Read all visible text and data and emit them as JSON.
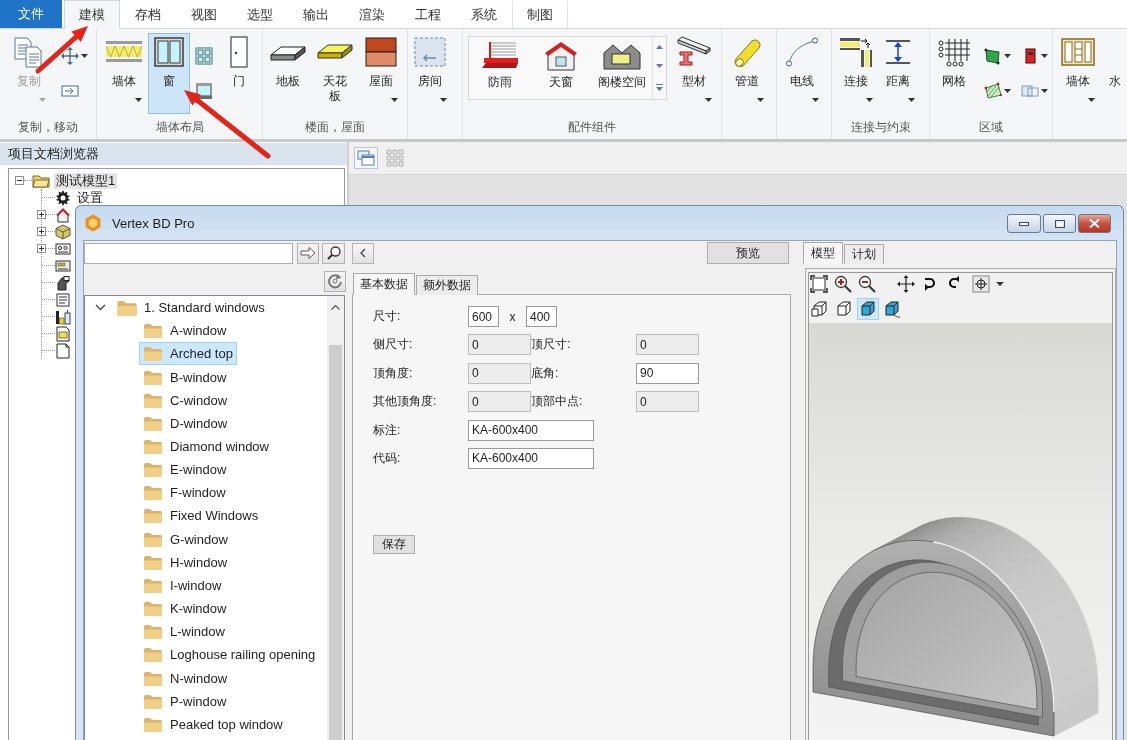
{
  "ribbon": {
    "file_menu": "文件",
    "tabs": [
      {
        "label": "建模",
        "selected": true
      },
      {
        "label": "存档",
        "selected": false
      },
      {
        "label": "视图",
        "selected": false
      },
      {
        "label": "选型",
        "selected": false
      },
      {
        "label": "输出",
        "selected": false
      },
      {
        "label": "渲染",
        "selected": false
      },
      {
        "label": "工程",
        "selected": false
      },
      {
        "label": "系统",
        "selected": false
      },
      {
        "label": "制图",
        "selected": false
      }
    ],
    "groups": [
      {
        "label": "复制，移动",
        "items": [
          {
            "kind": "large",
            "label": "复制",
            "selected": false,
            "disabled": true,
            "dropdown": true
          },
          {
            "kind": "small",
            "selected": false,
            "disabled": false,
            "dropdown": true
          },
          {
            "kind": "small",
            "selected": false,
            "disabled": false,
            "dropdown": false
          }
        ]
      },
      {
        "label": "墙体布局",
        "items": [
          {
            "kind": "large",
            "label": "墙体",
            "selected": false,
            "disabled": false,
            "dropdown": true
          },
          {
            "kind": "large",
            "label": "窗",
            "selected": true,
            "disabled": false,
            "dropdown": false
          },
          {
            "kind": "small",
            "selected": false,
            "disabled": false,
            "dropdown": false
          },
          {
            "kind": "small",
            "selected": false,
            "disabled": false,
            "dropdown": false
          },
          {
            "kind": "large",
            "label": "门",
            "selected": false,
            "disabled": false,
            "dropdown": false
          }
        ]
      },
      {
        "label": "楼面，屋面",
        "items": [
          {
            "kind": "large",
            "label": "地板",
            "selected": false,
            "disabled": false,
            "dropdown": false
          },
          {
            "kind": "large",
            "label": "天花板",
            "selected": false,
            "disabled": false,
            "dropdown": false
          },
          {
            "kind": "large",
            "label": "屋面",
            "selected": false,
            "disabled": false,
            "dropdown": true
          }
        ]
      },
      {
        "items": [
          {
            "kind": "large",
            "label": "房间",
            "selected": false,
            "disabled": false,
            "dropdown": true
          }
        ]
      },
      {
        "label": "配件组件",
        "items": [
          {
            "kind": "gallery",
            "entries": [
              {
                "label": "防雨"
              },
              {
                "label": "天窗"
              },
              {
                "label": "阁楼空间"
              }
            ]
          },
          {
            "kind": "large",
            "label": "型材",
            "selected": false,
            "disabled": false,
            "dropdown": true
          }
        ]
      },
      {
        "items": [
          {
            "kind": "large",
            "label": "管道",
            "selected": false,
            "disabled": false,
            "dropdown": true
          }
        ]
      },
      {
        "items": [
          {
            "kind": "large",
            "label": "电线",
            "selected": false,
            "disabled": false,
            "dropdown": true
          }
        ]
      },
      {
        "label": "连接与约束",
        "items": [
          {
            "kind": "large",
            "label": "连接",
            "selected": false,
            "disabled": false,
            "dropdown": true
          },
          {
            "kind": "large",
            "label": "距离",
            "selected": false,
            "disabled": false,
            "dropdown": true
          }
        ]
      },
      {
        "label": "区域",
        "items": [
          {
            "kind": "large",
            "label": "网格",
            "selected": false,
            "disabled": false,
            "dropdown": false
          },
          {
            "kind": "small",
            "selected": false,
            "disabled": false,
            "dropdown": true
          },
          {
            "kind": "small",
            "selected": false,
            "disabled": false,
            "dropdown": true
          },
          {
            "kind": "small",
            "selected": false,
            "disabled": false,
            "dropdown": true
          },
          {
            "kind": "small",
            "selected": false,
            "disabled": false,
            "dropdown": true
          }
        ]
      },
      {
        "items": [
          {
            "kind": "large",
            "label": "墙体",
            "selected": false,
            "disabled": false,
            "dropdown": true
          },
          {
            "kind": "large",
            "label": "水",
            "selected": false,
            "disabled": false,
            "dropdown": false
          }
        ]
      }
    ]
  },
  "project_browser": {
    "title": "项目文档浏览器",
    "tree": [
      {
        "label": "测试模型1",
        "selected": true,
        "expanded": true,
        "children": [
          {
            "kind": "item",
            "label": "设置",
            "selected": false
          },
          {
            "kind": "group",
            "expanded": false,
            "selected": false
          },
          {
            "kind": "group",
            "expanded": false,
            "selected": false
          },
          {
            "kind": "group",
            "expanded": false,
            "selected": false
          },
          {
            "kind": "item",
            "selected": false
          },
          {
            "kind": "item",
            "selected": false
          },
          {
            "kind": "item",
            "selected": false
          },
          {
            "kind": "item",
            "selected": false
          },
          {
            "kind": "item",
            "selected": false
          },
          {
            "kind": "item",
            "selected": false
          }
        ]
      }
    ]
  },
  "dialog": {
    "title": "Vertex BD Pro",
    "library_tree": [
      {
        "label": "1. Standard windows",
        "expanded": true,
        "selected": false,
        "children": [
          {
            "label": "A-window",
            "selected": false
          },
          {
            "label": "Arched top",
            "selected": true
          },
          {
            "label": "B-window",
            "selected": false
          },
          {
            "label": "C-window",
            "selected": false
          },
          {
            "label": "D-window",
            "selected": false
          },
          {
            "label": "Diamond window",
            "selected": false
          },
          {
            "label": "E-window",
            "selected": false
          },
          {
            "label": "F-window",
            "selected": false
          },
          {
            "label": "Fixed Windows",
            "selected": false
          },
          {
            "label": "G-window",
            "selected": false
          },
          {
            "label": "H-window",
            "selected": false
          },
          {
            "label": "I-window",
            "selected": false
          },
          {
            "label": "K-window",
            "selected": false
          },
          {
            "label": "L-window",
            "selected": false
          },
          {
            "label": "Loghouse railing opening",
            "selected": false
          },
          {
            "label": "N-window",
            "selected": false
          },
          {
            "label": "P-window",
            "selected": false
          },
          {
            "label": "Peaked top window",
            "selected": false
          }
        ]
      }
    ],
    "preview_button": "预览",
    "data_tabs": [
      {
        "label": "基本数据",
        "selected": true
      },
      {
        "label": "额外数据",
        "selected": false
      }
    ],
    "form_rows": [
      {
        "kind": "size",
        "cells": [
          {
            "label": "尺寸:",
            "value": "600",
            "disabled": false
          },
          {
            "label": "x",
            "value": "400",
            "disabled": false
          }
        ]
      },
      {
        "kind": "pair",
        "cells": [
          {
            "label": "侧尺寸:",
            "value": "0",
            "disabled": true
          },
          {
            "label": "顶尺寸:",
            "value": "0",
            "disabled": true
          }
        ]
      },
      {
        "kind": "pair",
        "cells": [
          {
            "label": "顶角度:",
            "value": "0",
            "disabled": true
          },
          {
            "label": "底角:",
            "value": "90",
            "disabled": false
          }
        ]
      },
      {
        "kind": "pair",
        "cells": [
          {
            "label": "其他顶角度:",
            "value": "0",
            "disabled": true
          },
          {
            "label": "顶部中点:",
            "value": "0",
            "disabled": true
          }
        ]
      },
      {
        "kind": "wide",
        "cells": [
          {
            "label": "标注:",
            "value": "KA-600x400",
            "disabled": false
          }
        ]
      },
      {
        "kind": "wide",
        "cells": [
          {
            "label": "代码:",
            "value": "KA-600x400",
            "disabled": false
          }
        ]
      }
    ],
    "save_button": "保存",
    "view_tabs": [
      {
        "label": "模型",
        "selected": true
      },
      {
        "label": "计划",
        "selected": false
      }
    ],
    "view_modes": [
      {
        "selected": false
      },
      {
        "selected": false
      },
      {
        "selected": true
      },
      {
        "selected": false
      }
    ]
  }
}
